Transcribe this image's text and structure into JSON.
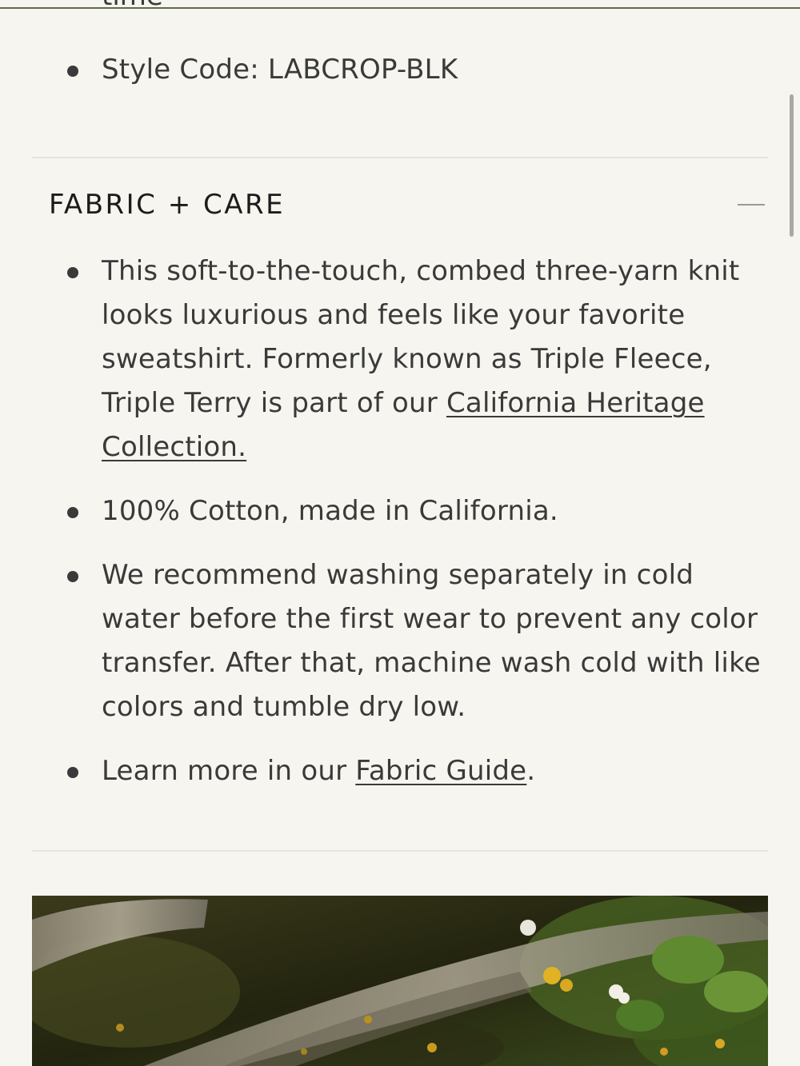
{
  "header": {
    "cut_text": "time"
  },
  "details": {
    "items": [
      {
        "text": "Style Code: LABCROP-BLK"
      }
    ]
  },
  "fabric_care": {
    "title": "FABRIC + CARE",
    "toggle_state": "expanded",
    "items": [
      {
        "text_before": "This soft-to-the-touch, combed three-yarn knit looks luxurious and feels like your favorite sweatshirt. Formerly known as Triple Fleece, Triple Terry is part of our ",
        "link": "California Heritage Collection.",
        "text_after": ""
      },
      {
        "text_before": "100% Cotton, made in California.",
        "link": "",
        "text_after": ""
      },
      {
        "text_before": "We recommend washing separately in cold water before the first wear to prevent any color transfer. After that, machine wash cold with like colors and tumble dry low.",
        "link": "",
        "text_after": ""
      },
      {
        "text_before": "Learn more in our ",
        "link": "Fabric Guide",
        "text_after": "."
      }
    ]
  },
  "colors": {
    "background": "#f6f5ef",
    "text": "#3a3a3a",
    "heading": "#1c1c1c",
    "top_rule": "#5f6b4b",
    "divider": "#e6e4dc"
  },
  "icons": {
    "collapse": "minus-icon",
    "bullet": "bullet-dot-icon"
  }
}
